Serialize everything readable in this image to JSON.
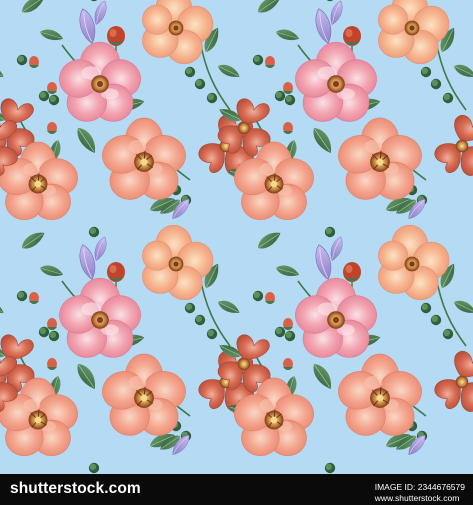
{
  "image": {
    "subject": "seamless floral pattern with pink and peach flowers, green leaves, red and purple buds",
    "background_color": "#b5daf3",
    "palette": {
      "flower_peach": "#f4a58e",
      "flower_pink": "#f2a3b0",
      "flower_coral": "#d76a52",
      "leaf": "#3f7a4d",
      "bud_red": "#c2432b",
      "bud_purple": "#a89ad8"
    }
  },
  "footer": {
    "brand": "shutterstock.com",
    "credit_line1": "IMAGE ID: 2344676579",
    "credit_line2": "www.shutterstock.com",
    "background_color": "#0a0a0a",
    "text_color": "#ffffff"
  }
}
